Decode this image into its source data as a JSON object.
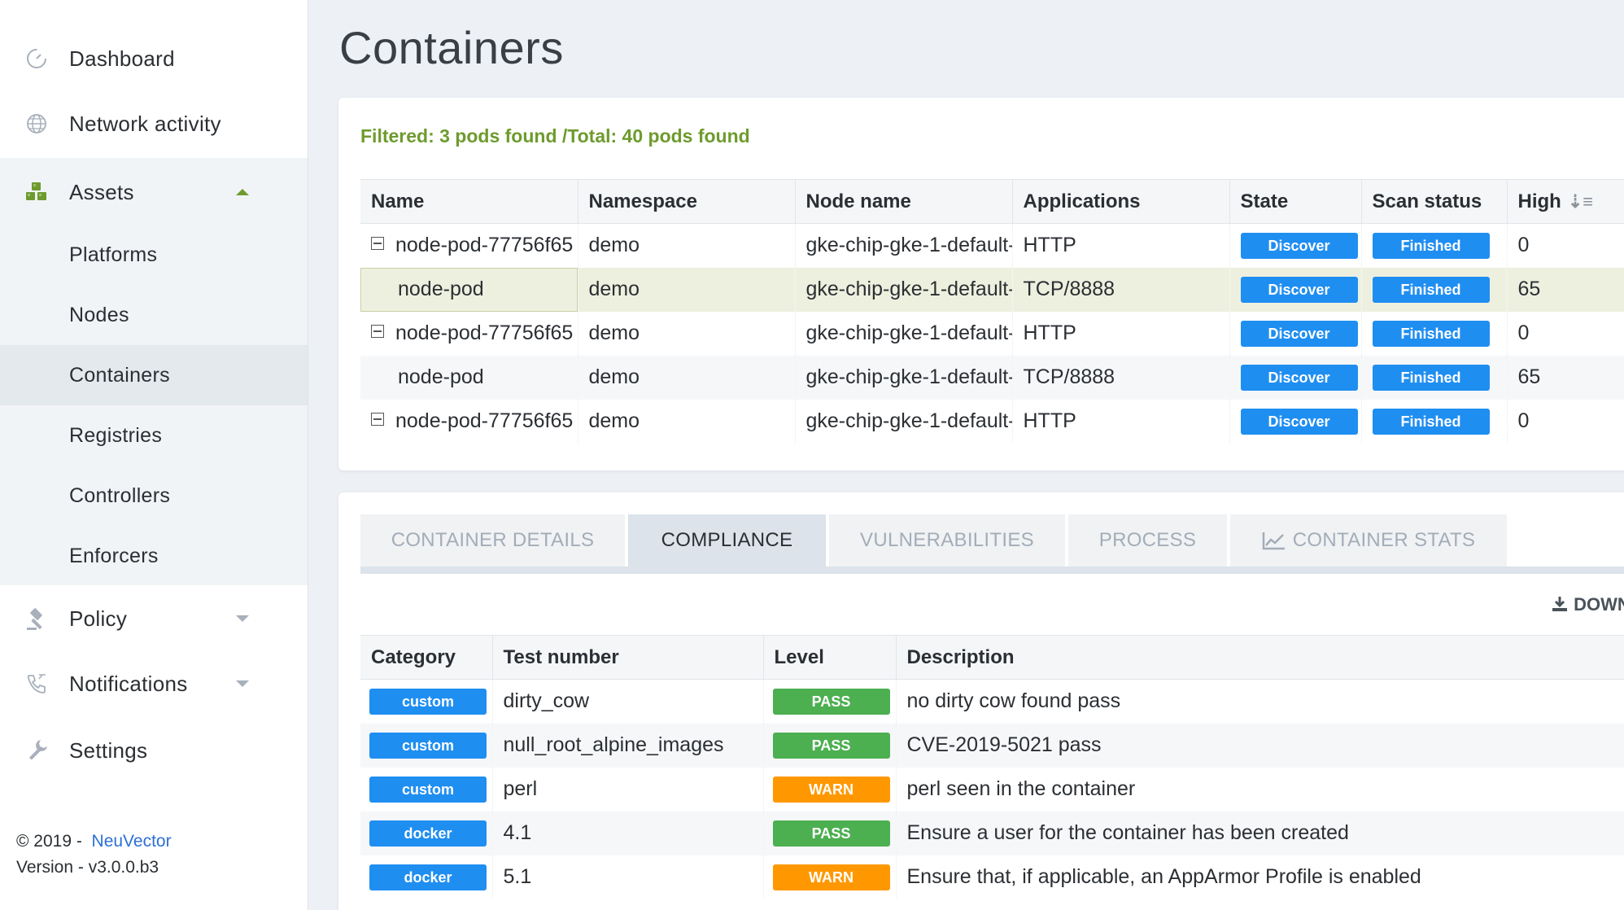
{
  "sidebar": {
    "items": [
      {
        "label": "Dashboard",
        "icon": "dashboard-icon"
      },
      {
        "label": "Network activity",
        "icon": "globe-icon"
      },
      {
        "label": "Assets",
        "icon": "cubes-icon",
        "expanded": true
      },
      {
        "label": "Policy",
        "icon": "gavel-icon"
      },
      {
        "label": "Notifications",
        "icon": "phone-icon"
      },
      {
        "label": "Settings",
        "icon": "wrench-icon"
      }
    ],
    "sub_items": [
      "Platforms",
      "Nodes",
      "Containers",
      "Registries",
      "Controllers",
      "Enforcers"
    ],
    "active_sub_item": "Containers",
    "footer": {
      "copyright": "© 2019 -",
      "brand": "NeuVector",
      "version": "Version - v3.0.0.b3"
    }
  },
  "page": {
    "title": "Containers"
  },
  "pods": {
    "filter_text": "Filtered: 3 pods found /Total: 40 pods found",
    "columns": [
      "Name",
      "Namespace",
      "Node name",
      "Applications",
      "State",
      "Scan status",
      "High"
    ],
    "rows": [
      {
        "name": "node-pod-77756f65",
        "namespace": "demo",
        "node": "gke-chip-gke-1-default-",
        "app": "HTTP",
        "state": "Discover",
        "scan": "Finished",
        "high": "0"
      },
      {
        "name": "node-pod",
        "namespace": "demo",
        "node": "gke-chip-gke-1-default-",
        "app": "TCP/8888",
        "state": "Discover",
        "scan": "Finished",
        "high": "65"
      },
      {
        "name": "node-pod-77756f65",
        "namespace": "demo",
        "node": "gke-chip-gke-1-default-",
        "app": "HTTP",
        "state": "Discover",
        "scan": "Finished",
        "high": "0"
      },
      {
        "name": "node-pod",
        "namespace": "demo",
        "node": "gke-chip-gke-1-default-",
        "app": "TCP/8888",
        "state": "Discover",
        "scan": "Finished",
        "high": "65"
      },
      {
        "name": "node-pod-77756f65",
        "namespace": "demo",
        "node": "gke-chip-gke-1-default-",
        "app": "HTTP",
        "state": "Discover",
        "scan": "Finished",
        "high": "0"
      }
    ]
  },
  "tabs": {
    "items": [
      "CONTAINER DETAILS",
      "COMPLIANCE",
      "VULNERABILITIES",
      "PROCESS",
      "CONTAINER STATS"
    ],
    "active": "COMPLIANCE"
  },
  "compliance": {
    "download_label": "DOWN",
    "columns": [
      "Category",
      "Test number",
      "Level",
      "Description"
    ],
    "rows": [
      {
        "category": "custom",
        "test": "dirty_cow",
        "level": "PASS",
        "description": "no dirty cow found pass"
      },
      {
        "category": "custom",
        "test": "null_root_alpine_images",
        "level": "PASS",
        "description": "CVE-2019-5021 pass"
      },
      {
        "category": "custom",
        "test": "perl",
        "level": "WARN",
        "description": "perl seen in the container"
      },
      {
        "category": "docker",
        "test": "4.1",
        "level": "PASS",
        "description": "Ensure a user for the container has been created"
      },
      {
        "category": "docker",
        "test": "5.1",
        "level": "WARN",
        "description": "Ensure that, if applicable, an AppArmor Profile is enabled"
      }
    ]
  },
  "colors": {
    "accent_green": "#6e9b2e",
    "pill_blue": "#1f8ef1",
    "pass_green": "#4caf50",
    "warn_orange": "#ff9800",
    "link_blue": "#2d6fd6"
  }
}
